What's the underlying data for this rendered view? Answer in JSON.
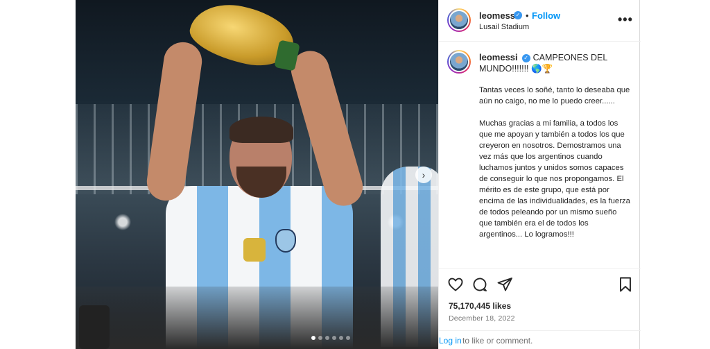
{
  "post": {
    "author": {
      "username": "leomessi",
      "verified_icon": "verified-badge-icon",
      "separator": "•",
      "follow_label": "Follow",
      "location": "Lusail Stadium"
    },
    "more_icon": "more-options-icon",
    "more_label": "•••",
    "media": {
      "next_icon": "chevron-right-icon",
      "next_label": "›",
      "carousel_dots": 6,
      "active_dot": 0
    },
    "caption": {
      "username": "leomessi",
      "headline": "CAMPEONES DEL MUNDO!!!!!!! 🌎🏆",
      "paragraphs": [
        "Tantas veces lo soñé, tanto lo deseaba que aún no caigo, no me lo puedo creer......",
        "Muchas gracias a mi familia, a todos los que me apoyan y también a todos los que creyeron en nosotros. Demostramos una vez más que los argentinos cuando luchamos juntos y unidos somos capaces de conseguir lo que nos propongamos. El mérito es de este grupo, que está por encima de las individualidades, es la fuerza de todos peleando por un mismo sueño que también era el de todos los argentinos... Lo logramos!!!"
      ]
    },
    "actions": {
      "like_icon": "heart-icon",
      "comment_icon": "comment-bubble-icon",
      "share_icon": "paper-plane-icon",
      "save_icon": "bookmark-icon"
    },
    "likes": "75,170,445 likes",
    "date": "December 18, 2022",
    "login_prompt": {
      "link": "Log in",
      "rest": "to like or comment."
    },
    "colors": {
      "accent": "#0095f6",
      "verified": "#3897f0",
      "text": "#262626",
      "muted": "#737373"
    }
  }
}
